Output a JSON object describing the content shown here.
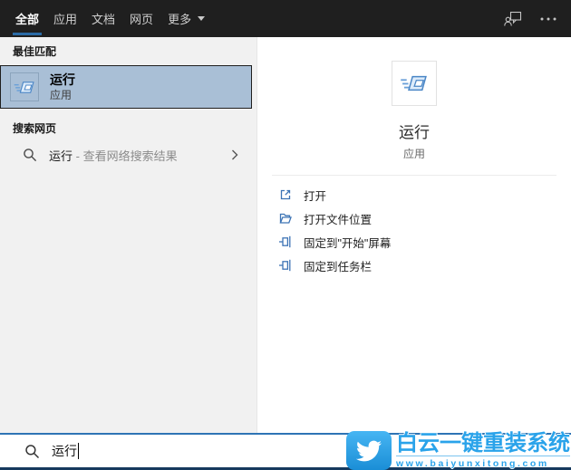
{
  "topbar": {
    "tabs": [
      {
        "label": "全部",
        "selected": true
      },
      {
        "label": "应用",
        "selected": false
      },
      {
        "label": "文档",
        "selected": false
      },
      {
        "label": "网页",
        "selected": false
      },
      {
        "label": "更多",
        "selected": false,
        "has_caret": true
      }
    ],
    "right_icons": [
      "feedback-icon",
      "more-options-icon"
    ]
  },
  "left_panel": {
    "best_match_header": "最佳匹配",
    "best_match": {
      "title": "运行",
      "subtitle": "应用",
      "icon": "run-app-icon"
    },
    "web_header": "搜索网页",
    "web_result": {
      "query": "运行",
      "suffix": " - 查看网络搜索结果",
      "icon": "search-icon",
      "chevron": "chevron-right-icon"
    }
  },
  "right_panel": {
    "app_title": "运行",
    "app_subtitle": "应用",
    "app_icon": "run-app-icon",
    "actions": [
      {
        "label": "打开",
        "icon": "open-icon"
      },
      {
        "label": "打开文件位置",
        "icon": "folder-location-icon"
      },
      {
        "label": "固定到\"开始\"屏幕",
        "icon": "pin-icon"
      },
      {
        "label": "固定到任务栏",
        "icon": "pin-icon"
      }
    ]
  },
  "search_bar": {
    "value": "运行",
    "icon": "search-icon"
  },
  "watermark": {
    "brand": "白云一键重装系统",
    "url": "www.baiyunxitong.com",
    "icon": "bird-logo-icon"
  },
  "colors": {
    "topbar_bg": "#1f1f1f",
    "accent_underline": "#2a6aa5",
    "selection_bg": "#a9bfd6",
    "left_panel_bg": "#f1f1f1",
    "action_icon_blue": "#3d74b5",
    "search_border_top": "#2e74b5",
    "search_border_bottom": "#16395d",
    "watermark_blue": "#2aa3ea"
  }
}
